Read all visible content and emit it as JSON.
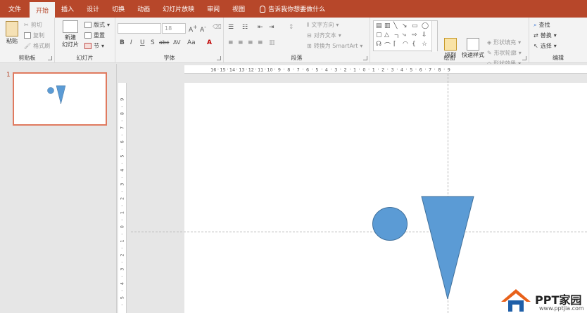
{
  "tabs": [
    {
      "label": "文件",
      "active": false
    },
    {
      "label": "开始",
      "active": true
    },
    {
      "label": "插入",
      "active": false
    },
    {
      "label": "设计",
      "active": false
    },
    {
      "label": "切换",
      "active": false
    },
    {
      "label": "动画",
      "active": false
    },
    {
      "label": "幻灯片放映",
      "active": false
    },
    {
      "label": "审阅",
      "active": false
    },
    {
      "label": "视图",
      "active": false
    }
  ],
  "tell_me": "告诉我你想要做什么",
  "ribbon": {
    "clipboard": {
      "label": "剪贴板",
      "paste": "粘贴",
      "cut": "剪切",
      "copy": "复制",
      "format_painter": "格式刷"
    },
    "slides": {
      "label": "幻灯片",
      "new_slide_line1": "新建",
      "new_slide_line2": "幻灯片",
      "layout": "版式",
      "reset": "重置",
      "section": "节"
    },
    "font": {
      "label": "字体",
      "font_name": "",
      "font_size": "18",
      "change_case": "Aa"
    },
    "paragraph": {
      "label": "段落",
      "text_direction": "文字方向",
      "align_text": "对齐文本",
      "smartart": "转换为 SmartArt"
    },
    "drawing": {
      "label": "绘图",
      "arrange": "排列",
      "quick_styles": "快速样式",
      "shape_fill": "形状填充",
      "shape_outline": "形状轮廓",
      "shape_effects": "形状效果"
    },
    "editing": {
      "label": "编辑",
      "find": "查找",
      "replace": "替换",
      "select": "选择"
    }
  },
  "thumbnails": [
    {
      "number": "1"
    }
  ],
  "ruler": {
    "h_ticks": [
      "16",
      "15",
      "14",
      "13",
      "12",
      "11",
      "10",
      "9",
      "8",
      "7",
      "6",
      "5",
      "4",
      "3",
      "2",
      "1",
      "0",
      "1",
      "2",
      "3",
      "4",
      "5",
      "6",
      "7",
      "8",
      "9"
    ],
    "v_ticks": [
      "9",
      "8",
      "7",
      "6",
      "5",
      "4",
      "3",
      "2",
      "1",
      "0",
      "1",
      "2",
      "3",
      "4",
      "5"
    ]
  },
  "shape_color": "#5b9bd5",
  "shape_stroke": "#41719c",
  "accent": "#b7472a",
  "watermark": {
    "title": "PPT家园",
    "url": "www.pptjia.com"
  }
}
